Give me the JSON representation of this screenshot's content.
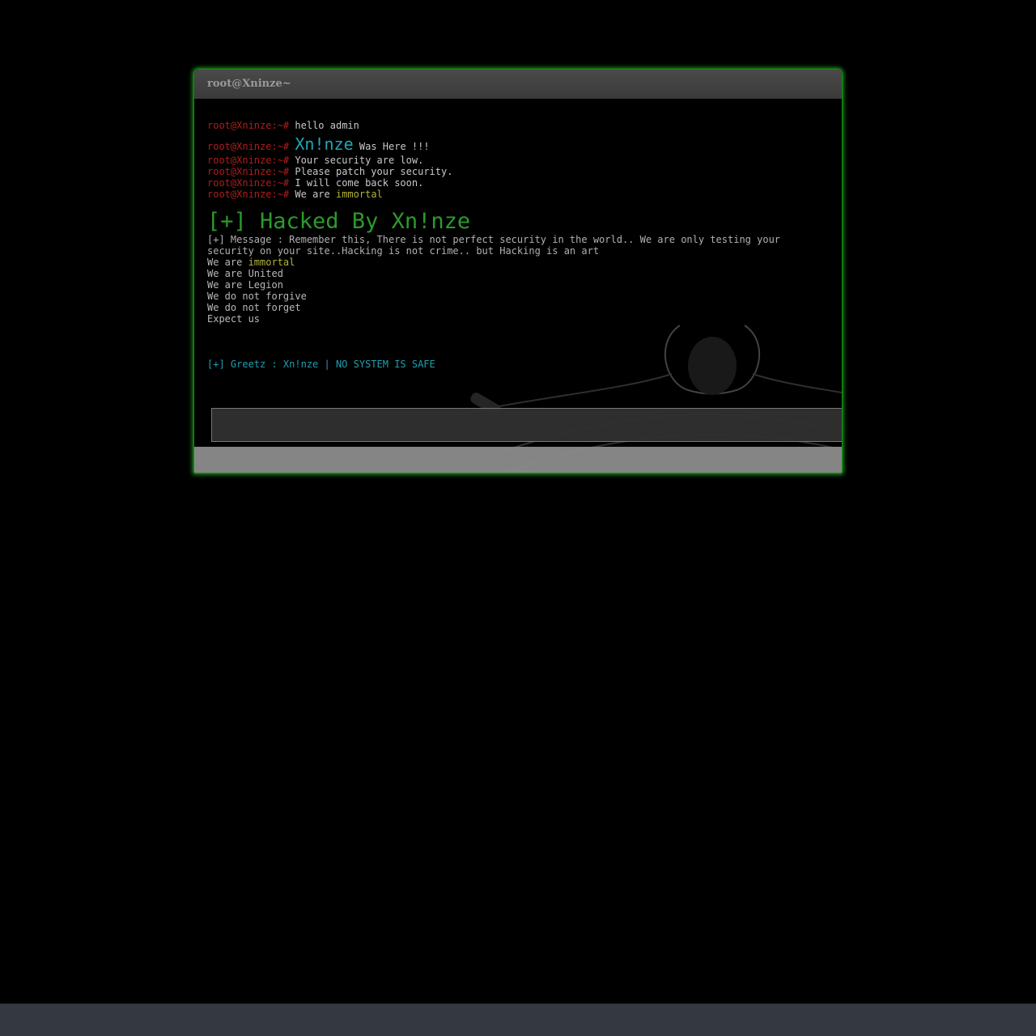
{
  "window": {
    "title": "root@Xninze~"
  },
  "terminal": {
    "prompt": "root@Xninze:~#",
    "lines": [
      {
        "text": "hello admin"
      },
      {
        "highlight": "Xn!nze",
        "text": " Was Here !!!"
      },
      {
        "text": "Your security are low."
      },
      {
        "text": "Please patch your security."
      },
      {
        "text": "I will come back soon."
      },
      {
        "text": "We are ",
        "highlight": "immortal"
      }
    ]
  },
  "banner": {
    "heading": "[+] Hacked By Xn!nze",
    "message": "[+] Message : Remember this, There is not perfect security in the world.. We are only testing your security on your site..Hacking is not crime.. but Hacking is an art",
    "motto": [
      {
        "prefix": "We are ",
        "highlight": "immortal"
      },
      {
        "prefix": "We are United"
      },
      {
        "prefix": "We are Legion"
      },
      {
        "prefix": "We do not forgive"
      },
      {
        "prefix": "We do not forget"
      },
      {
        "prefix": "Expect us"
      }
    ],
    "greetz": "[+] Greetz : Xn!nze | NO SYSTEM IS SAFE"
  },
  "colors": {
    "prompt": "#b11d1d",
    "cyan": "#1fa7b8",
    "yellow": "#b2b23b",
    "heading": "#2c9a2c",
    "glow": "#1fa81f"
  }
}
